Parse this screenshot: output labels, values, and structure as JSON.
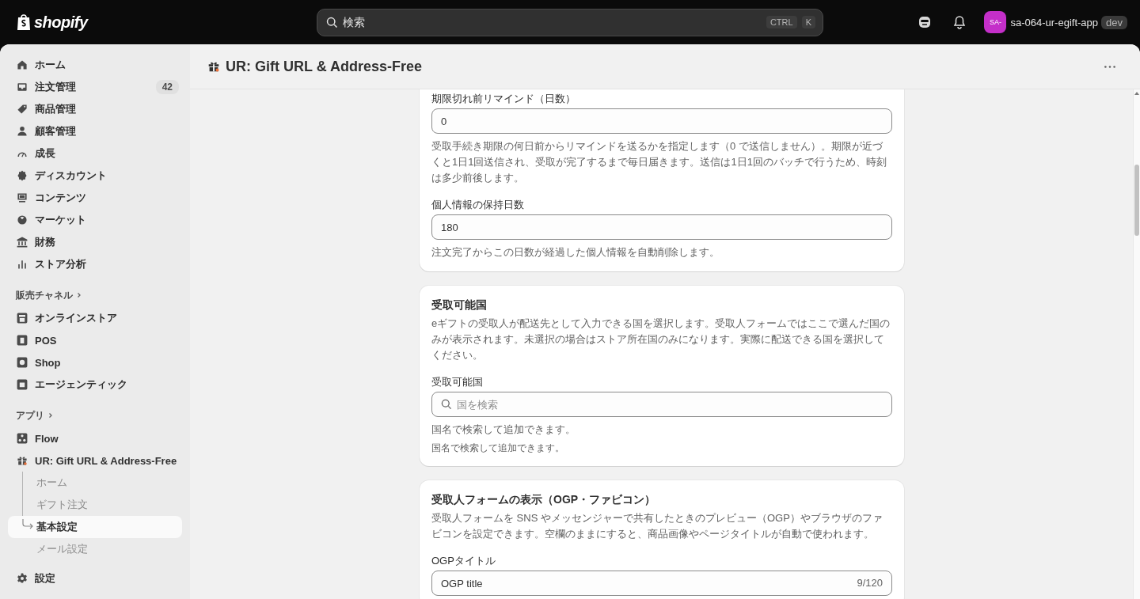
{
  "topbar": {
    "logo": "shopify",
    "search": {
      "placeholder": "検索",
      "shortcut": [
        "CTRL",
        "K"
      ]
    },
    "store": {
      "avatar": "SA-",
      "name": "sa-064-ur-egift-app",
      "badge": "dev"
    }
  },
  "sidebar": {
    "items": [
      {
        "label": "ホーム"
      },
      {
        "label": "注文管理",
        "badge": "42"
      },
      {
        "label": "商品管理"
      },
      {
        "label": "顧客管理"
      },
      {
        "label": "成長"
      },
      {
        "label": "ディスカウント"
      },
      {
        "label": "コンテンツ"
      },
      {
        "label": "マーケット"
      },
      {
        "label": "財務"
      },
      {
        "label": "ストア分析"
      }
    ],
    "sections": [
      {
        "title": "販売チャネル",
        "items": [
          {
            "label": "オンラインストア"
          },
          {
            "label": "POS"
          },
          {
            "label": "Shop"
          },
          {
            "label": "エージェンティック"
          }
        ]
      },
      {
        "title": "アプリ",
        "items": [
          {
            "label": "Flow"
          },
          {
            "label": "UR: Gift URL & Address-Free",
            "children": [
              {
                "label": "ホーム",
                "selected": false
              },
              {
                "label": "ギフト注文",
                "selected": false
              },
              {
                "label": "基本設定",
                "selected": true
              },
              {
                "label": "メール設定",
                "selected": false
              }
            ]
          }
        ]
      }
    ],
    "footer": {
      "label": "設定"
    }
  },
  "page": {
    "title": "UR: Gift URL & Address-Free",
    "cards": [
      {
        "fields": [
          {
            "kind": "text",
            "label": "期限切れ前リマインド（日数）",
            "value": "0",
            "help": "受取手続き期限の何日前からリマインドを送るかを指定します（0 で送信しません）。期限が近づくと1日1回送信され、受取が完了するまで毎日届きます。送信は1日1回のバッチで行うため、時刻は多少前後します。"
          },
          {
            "kind": "text",
            "label": "個人情報の保持日数",
            "value": "180",
            "help": "注文完了からこの日数が経過した個人情報を自動削除します。"
          }
        ]
      },
      {
        "title": "受取可能国",
        "description": "eギフトの受取人が配送先として入力できる国を選択します。受取人フォームではここで選んだ国のみが表示されます。未選択の場合はストア所在国のみになります。実際に配送できる国を選択してください。",
        "fields": [
          {
            "kind": "search",
            "label": "受取可能国",
            "placeholder": "国を検索",
            "help": "国名で検索して追加できます。"
          }
        ],
        "note": "国名で検索して追加できます。"
      },
      {
        "title": "受取人フォームの表示（OGP・ファビコン）",
        "description": "受取人フォームを SNS やメッセンジャーで共有したときのプレビュー（OGP）やブラウザのファビコンを設定できます。空欄のままにすると、商品画像やページタイトルが自動で使われます。",
        "fields": [
          {
            "kind": "text",
            "label": "OGPタイトル",
            "value": "OGP title",
            "counter": "9/120"
          }
        ]
      }
    ]
  }
}
